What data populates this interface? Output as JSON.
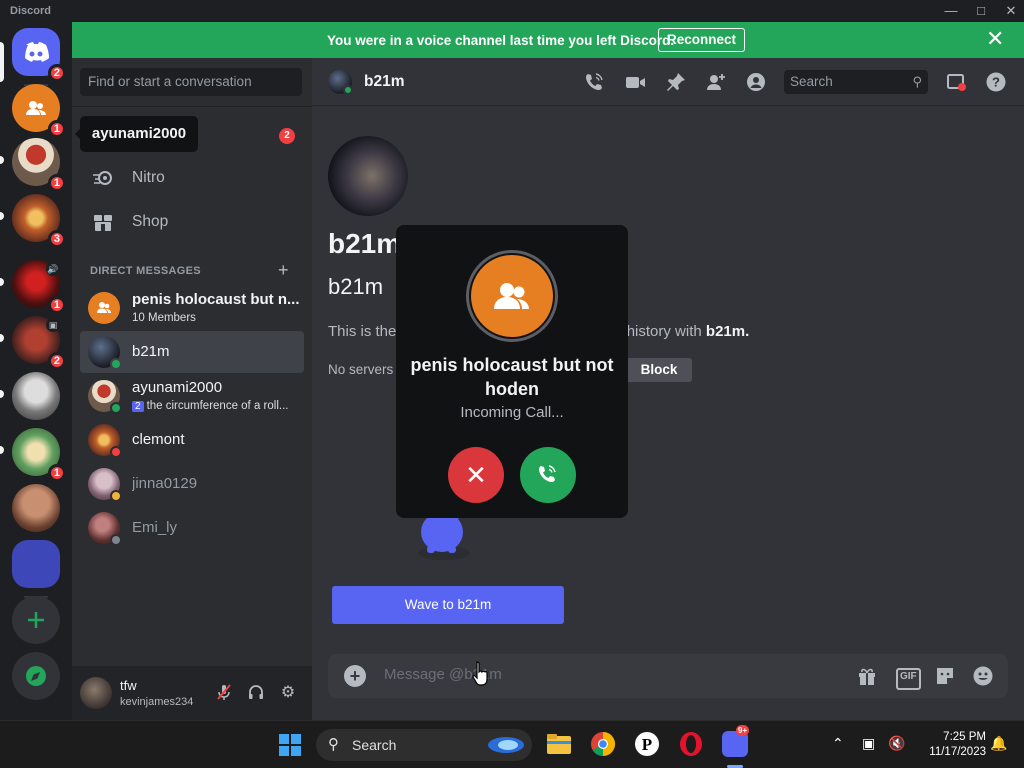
{
  "window": {
    "app_name": "Discord"
  },
  "banner": {
    "message": "You were in a voice channel last time you left Discord.",
    "reconnect_label": "Reconnect"
  },
  "rail": {
    "badges": [
      "2",
      "1",
      "1",
      "3",
      "1",
      "2",
      "1"
    ]
  },
  "tooltip": {
    "text": "ayunami2000"
  },
  "sidebar": {
    "search_placeholder": "Find or start a conversation",
    "friends_badge": "2",
    "nav": [
      {
        "label": "Nitro",
        "icon": "nitro-icon"
      },
      {
        "label": "Shop",
        "icon": "shop-icon"
      }
    ],
    "dm_heading": "DIRECT MESSAGES",
    "dms": [
      {
        "name": "penis holocaust but n...",
        "sub": "10 Members"
      },
      {
        "name": "b21m"
      },
      {
        "name": "ayunami2000",
        "count": "2",
        "sub": "the circumference of a roll..."
      },
      {
        "name": "clemont"
      },
      {
        "name": "jinna0129"
      },
      {
        "name": "Emi_ly"
      }
    ]
  },
  "user_panel": {
    "username": "tfw",
    "tag": "kevinjames234"
  },
  "header": {
    "name": "b21m",
    "search_placeholder": "Search"
  },
  "profile": {
    "display_name": "b21m",
    "username": "b21m",
    "history_prefix": "This is the",
    "history_suffix": "history with",
    "history_name": "b21m.",
    "no_servers": "No servers",
    "block_label": "Block",
    "wave_label": "Wave to b21m"
  },
  "composer": {
    "placeholder": "Message @b21m"
  },
  "call": {
    "title": "penis holocaust but not hoden",
    "status": "Incoming Call..."
  },
  "taskbar": {
    "search_label": "Search",
    "time": "7:25 PM",
    "date": "11/17/2023",
    "discord_badge": "9+"
  },
  "colors": {
    "discord_blurple": "#5865f2",
    "banner_green": "#23a55a",
    "danger_red": "#da373c",
    "group_orange": "#e67e22"
  }
}
